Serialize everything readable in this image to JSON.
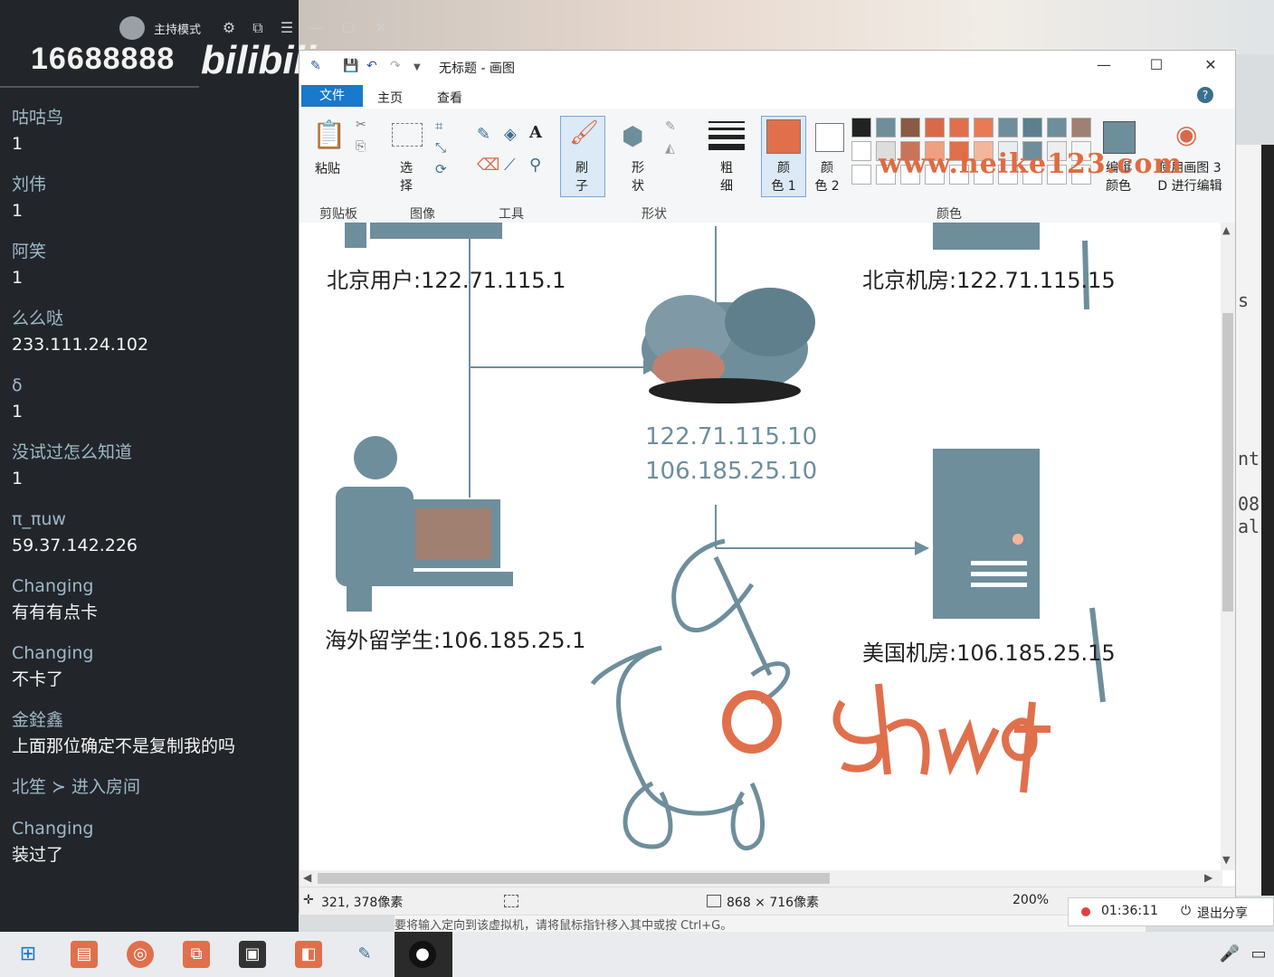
{
  "chat": {
    "host_mode": "主持模式",
    "room_number": "16688888",
    "logo": "bilibili",
    "messages": [
      {
        "user": "咕咕鸟",
        "text": "1"
      },
      {
        "user": "刘伟",
        "text": "1"
      },
      {
        "user": "阿笑",
        "text": "1"
      },
      {
        "user": "么么哒",
        "text": "233.111.24.102"
      },
      {
        "user": "δ",
        "text": "1"
      },
      {
        "user": "没试过怎么知道",
        "text": "1"
      },
      {
        "user": "π_πuw",
        "text": "59.37.142.226"
      },
      {
        "user": "Changing",
        "text": "有有有点卡"
      },
      {
        "user": "Changing",
        "text": "不卡了"
      },
      {
        "user": "金銓鑫",
        "text": "上面那位确定不是复制我的吗"
      },
      {
        "system": "北笙 ≻ 进入房间"
      },
      {
        "user": "Changing",
        "text": "装过了"
      }
    ]
  },
  "paint": {
    "title": "无标题 - 画图",
    "menu": {
      "file": "文件",
      "home": "主页",
      "view": "查看"
    },
    "ribbon": {
      "paste": "粘贴",
      "select": "选\n择",
      "brush": "刷\n子",
      "shape": "形\n状",
      "thickness": "粗\n细",
      "color1": "颜\n色 1",
      "color2": "颜\n色 2",
      "edit_colors": "编辑\n颜色",
      "paint3d": "使用画图 3\nD 进行编辑",
      "groups": [
        "剪贴板",
        "图像",
        "工具",
        "形状",
        "颜色"
      ],
      "color1_value": "#e0704c"
    },
    "watermark": "www.heike123.com",
    "canvas": {
      "beijing_user": "北京用户:122.71.115.1",
      "beijing_room": "北京机房:122.71.115.15",
      "cloud_ip1": "122.71.115.10",
      "cloud_ip2": "106.185.25.10",
      "overseas_student": "海外留学生:106.185.25.1",
      "us_room": "美国机房:106.185.25.15",
      "handwriting": "shoot"
    },
    "status": {
      "cursor": "321, 378像素",
      "size": "868 × 716像素",
      "zoom": "200%"
    }
  },
  "share": {
    "time": "01:36:11",
    "exit": "退出分享"
  },
  "hint": "要将输入定向到该虚拟机，请将鼠标指针移入其中或按 Ctrl+G。",
  "terminal": {
    "line1": "s",
    "line2": "nt",
    "line3": "08",
    "line4": "al"
  },
  "colors": {
    "accent": "#1979ca",
    "diagram": "#6e8e9c",
    "orange": "#e0704c"
  }
}
